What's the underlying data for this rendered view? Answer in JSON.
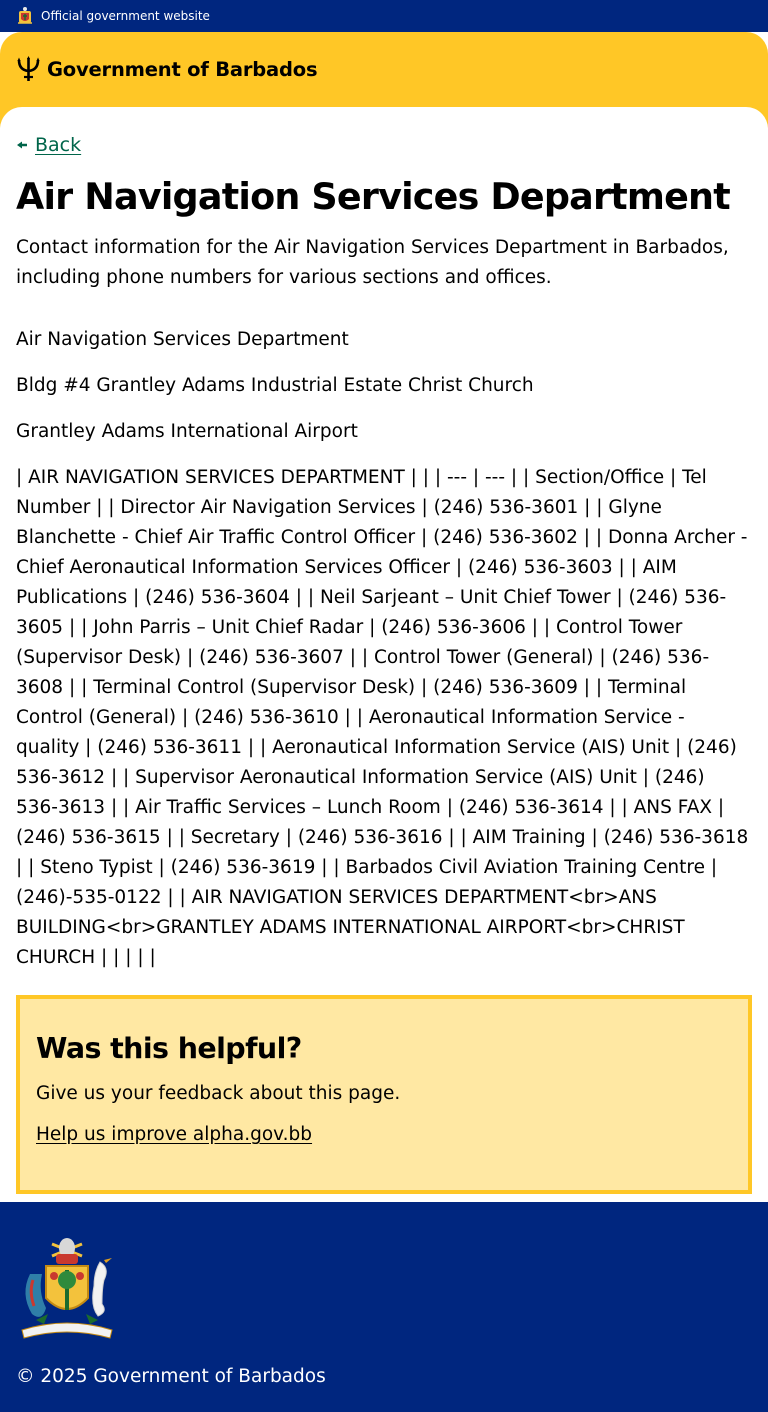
{
  "official_bar": {
    "label": "Official government website",
    "crest_icon": "coat-of-arms-icon"
  },
  "header": {
    "brand_name": "Government of Barbados",
    "brand_icon": "trident-icon",
    "colors": {
      "navy": "#00267f",
      "gold": "#ffc726",
      "link_green": "#00654a"
    }
  },
  "nav": {
    "back_label": "Back",
    "back_icon": "arrow-left-icon"
  },
  "page": {
    "title": "Air Navigation Services Department",
    "description": "Contact information for the Air Navigation Services Department in Barbados, including phone numbers for various sections and offices.",
    "paragraphs": [
      "Air Navigation Services Department",
      "Bldg #4 Grantley Adams Industrial Estate Christ Church",
      "Grantley Adams International Airport",
      "| AIR NAVIGATION SERVICES DEPARTMENT | | | --- | --- | | Section/Office | Tel Number | | Director Air Navigation Services | (246) 536-3601 | | Glyne Blanchette - Chief Air Traffic Control Officer | (246) 536-3602 | | Donna Archer - Chief Aeronautical Information Services Officer | (246) 536-3603 | | AIM Publications | (246) 536-3604 | | Neil Sarjeant – Unit Chief Tower | (246) 536-3605 | | John Parris – Unit Chief Radar | (246) 536-3606 | | Control Tower (Supervisor Desk) | (246) 536-3607 | | Control Tower (General) | (246) 536-3608 | | Terminal Control (Supervisor Desk) | (246) 536-3609 | | Terminal Control (General) | (246) 536-3610 | | Aeronautical Information Service - quality | (246) 536-3611 | | Aeronautical Information Service (AIS) Unit | (246) 536-3612 | | Supervisor Aeronautical Information Service (AIS) Unit | (246) 536-3613 | | Air Traffic Services – Lunch Room | (246) 536-3614 | | ANS FAX | (246) 536-3615 | | Secretary | (246) 536-3616 | | AIM Training | (246) 536-3618 | | Steno Typist | (246) 536-3619 | | Barbados Civil Aviation Training Centre | (246)-535-0122 | | AIR NAVIGATION SERVICES DEPARTMENT<br>ANS BUILDING<br>GRANTLEY ADAMS INTERNATIONAL AIRPORT<br>CHRIST CHURCH | | | | |"
    ]
  },
  "feedback": {
    "heading": "Was this helpful?",
    "text": "Give us your feedback about this page.",
    "link_label": "Help us improve alpha.gov.bb"
  },
  "footer": {
    "crest_icon": "coat-of-arms-icon",
    "copyright": "© 2025 Government of Barbados"
  }
}
